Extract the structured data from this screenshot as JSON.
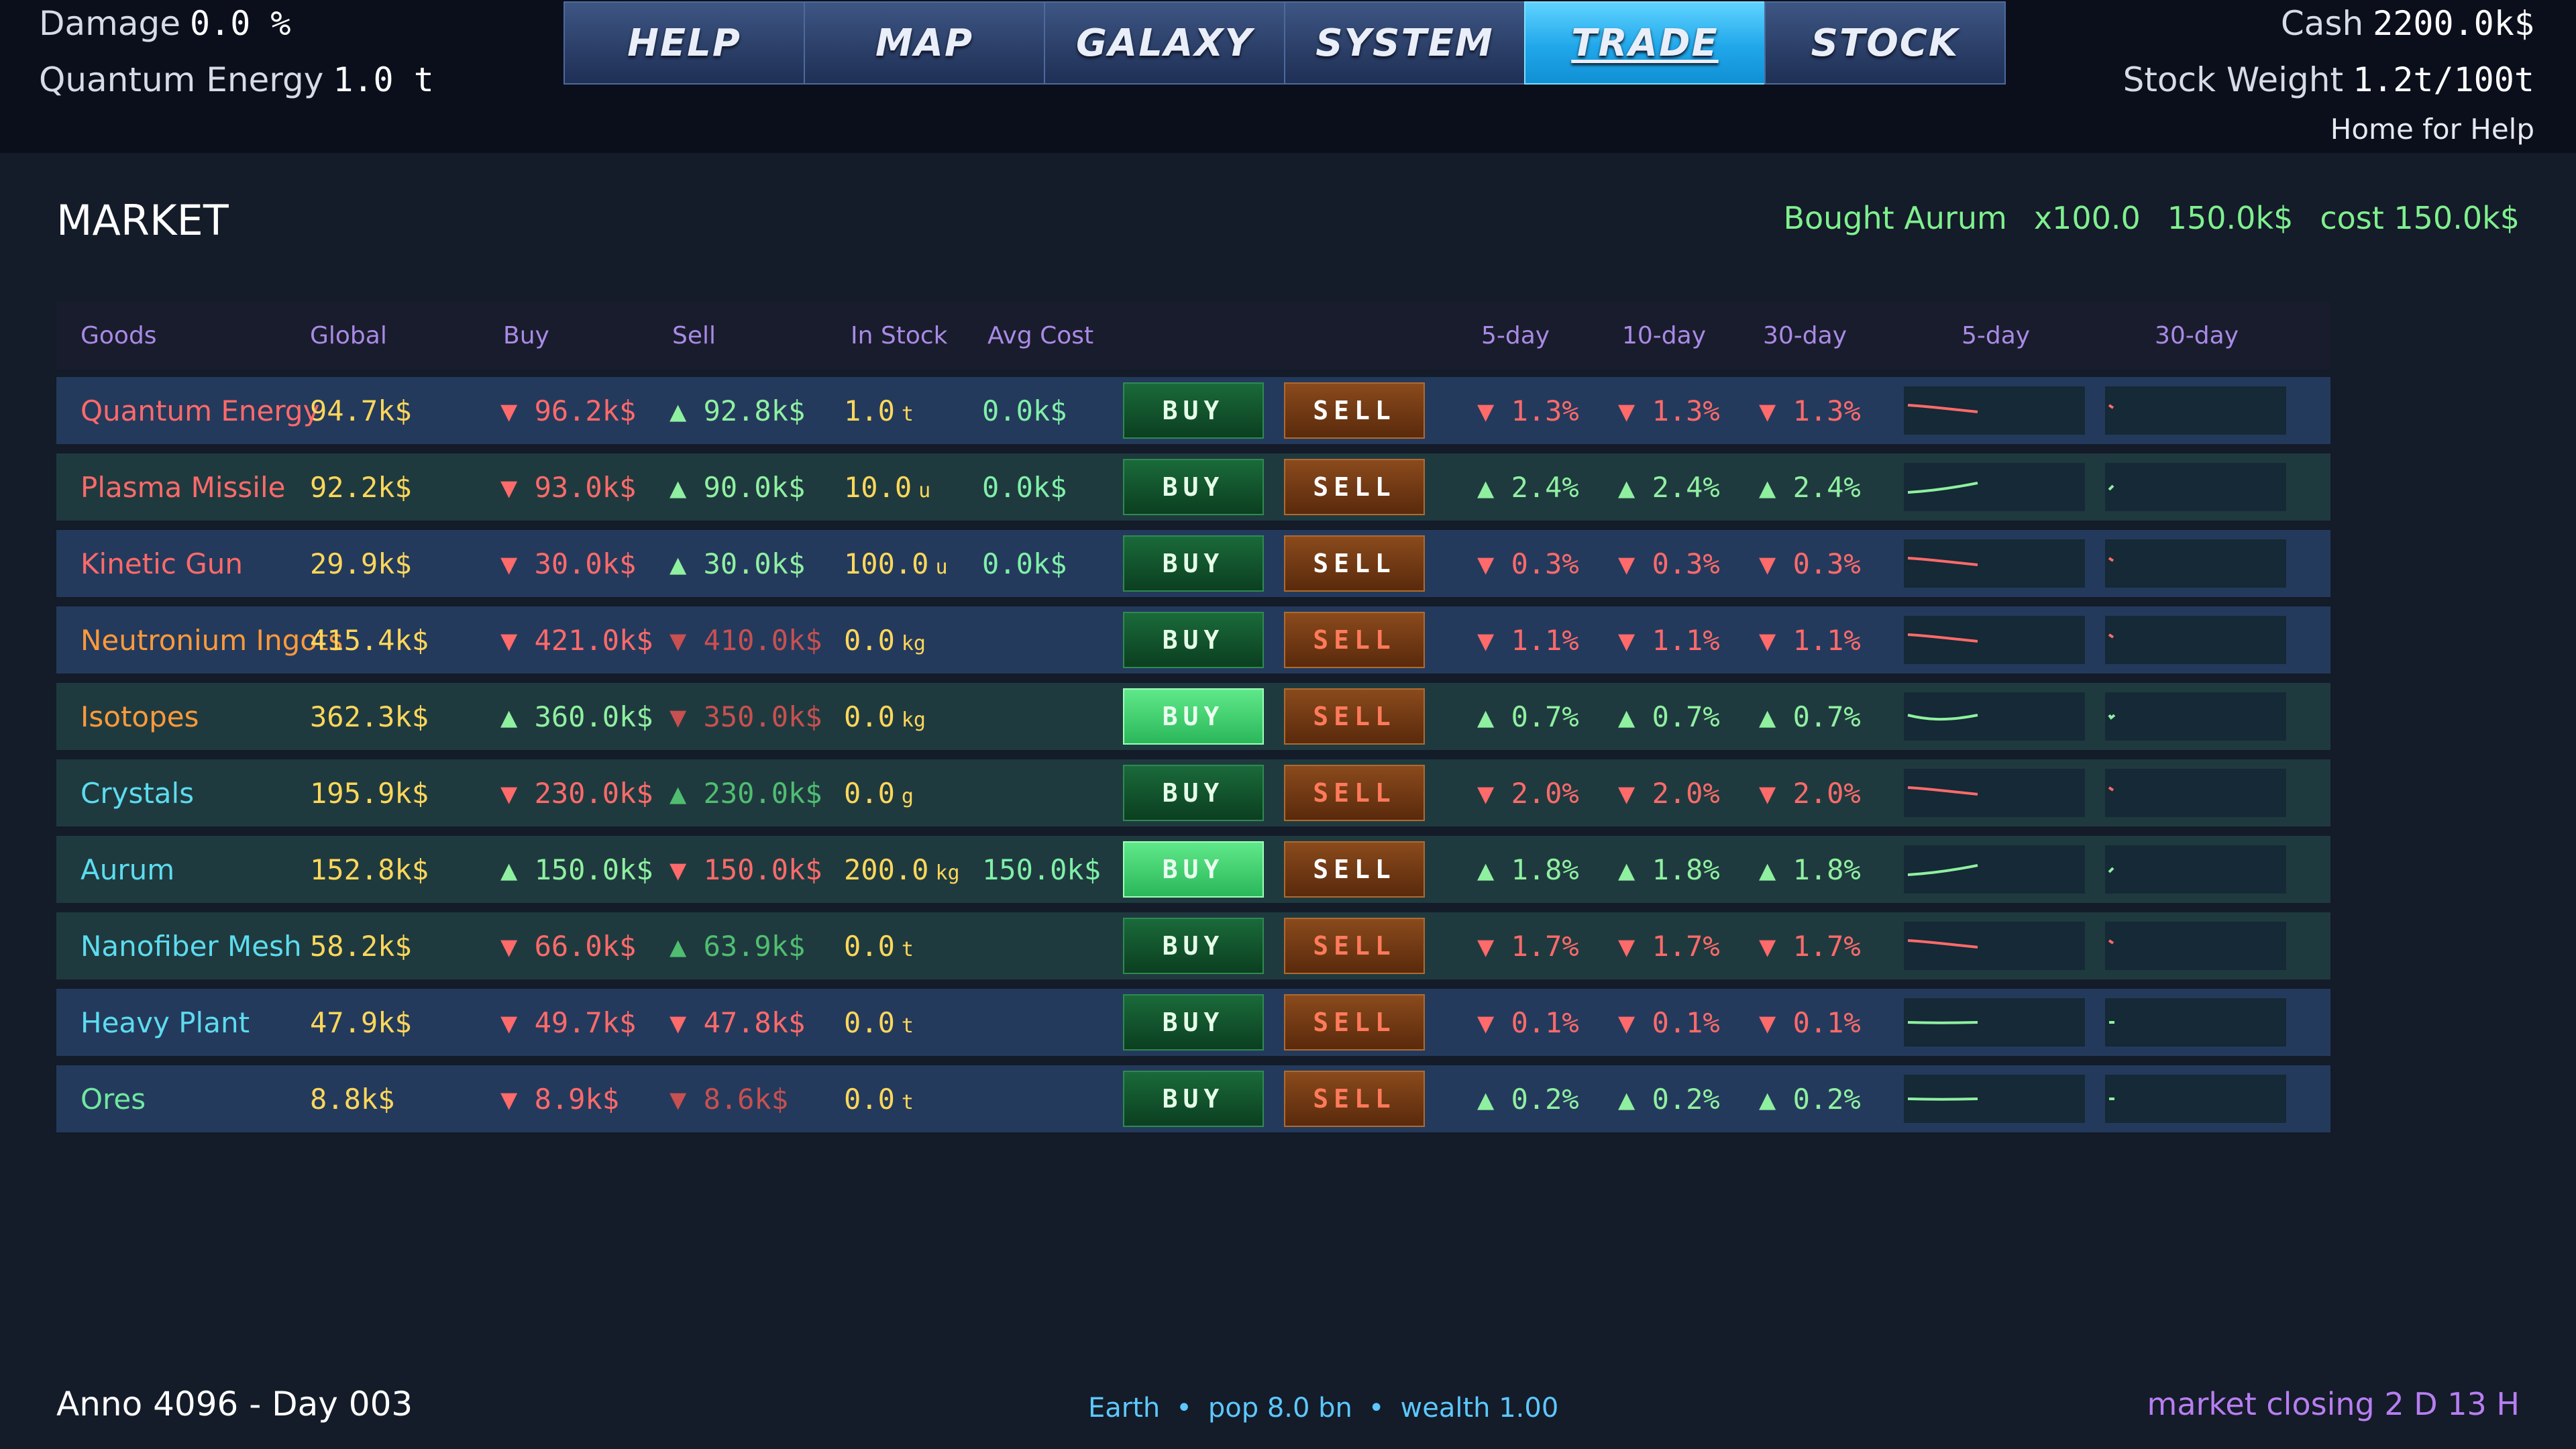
{
  "hud": {
    "damage_label": "Damage",
    "damage_value": "0.0 %",
    "qe_label": "Quantum Energy",
    "qe_value": "1.0 t",
    "cash_label": "Cash",
    "cash_value": "2200.0k$",
    "weight_label": "Stock Weight",
    "weight_value": "1.2t/100t",
    "help_hint": "Home for Help"
  },
  "tabs": [
    "HELP",
    "MAP",
    "GALAXY",
    "SYSTEM",
    "TRADE",
    "STOCK"
  ],
  "active_tab": "TRADE",
  "market": {
    "title": "MARKET",
    "last_trade": {
      "action": "Bought Aurum",
      "qty": "x100.0",
      "price": "150.0k$",
      "cost": "cost 150.0k$"
    },
    "columns": [
      "Goods",
      "Global",
      "Buy",
      "Sell",
      "In Stock",
      "Avg Cost",
      "5-day",
      "10-day",
      "30-day",
      "5-day",
      "30-day"
    ],
    "buy_label": "BUY",
    "sell_label": "SELL",
    "rows": [
      {
        "name": "Quantum Energy",
        "name_color": "#ff6a6a",
        "global": "94.7k$",
        "buy": "▼ 96.2k$",
        "buy_cls": "down",
        "sell": "▲ 92.8k$",
        "sell_cls": "up",
        "stock": "1.0",
        "unit": "t",
        "avg": "0.0k$",
        "d5": "▼ 1.3%",
        "d10": "▼ 1.3%",
        "d30": "▼ 1.3%",
        "trend": "down",
        "buy_lit": false,
        "sell_warn": false,
        "bg": "blue"
      },
      {
        "name": "Plasma Missile",
        "name_color": "#ff6a6a",
        "global": "92.2k$",
        "buy": "▼ 93.0k$",
        "buy_cls": "down",
        "sell": "▲ 90.0k$",
        "sell_cls": "up",
        "stock": "10.0",
        "unit": "u",
        "avg": "0.0k$",
        "d5": "▲ 2.4%",
        "d10": "▲ 2.4%",
        "d30": "▲ 2.4%",
        "trend": "up",
        "buy_lit": false,
        "sell_warn": false,
        "bg": "green"
      },
      {
        "name": "Kinetic Gun",
        "name_color": "#ff6a6a",
        "global": "29.9k$",
        "buy": "▼ 30.0k$",
        "buy_cls": "down",
        "sell": "▲ 30.0k$",
        "sell_cls": "up",
        "stock": "100.0",
        "unit": "u",
        "avg": "0.0k$",
        "d5": "▼ 0.3%",
        "d10": "▼ 0.3%",
        "d30": "▼ 0.3%",
        "trend": "down",
        "buy_lit": false,
        "sell_warn": false,
        "bg": "blue"
      },
      {
        "name": "Neutronium Ingots",
        "name_color": "#ff9a3a",
        "global": "415.4k$",
        "buy": "▼ 421.0k$",
        "buy_cls": "down",
        "sell": "▼ 410.0k$",
        "sell_cls": "dim-down",
        "stock": "0.0",
        "unit": "kg",
        "avg": "",
        "d5": "▼ 1.1%",
        "d10": "▼ 1.1%",
        "d30": "▼ 1.1%",
        "trend": "down",
        "buy_lit": false,
        "sell_warn": true,
        "bg": "blue"
      },
      {
        "name": "Isotopes",
        "name_color": "#ff9a3a",
        "global": "362.3k$",
        "buy": "▲ 360.0k$",
        "buy_cls": "up",
        "sell": "▼ 350.0k$",
        "sell_cls": "dim-down",
        "stock": "0.0",
        "unit": "kg",
        "avg": "",
        "d5": "▲ 0.7%",
        "d10": "▲ 0.7%",
        "d30": "▲ 0.7%",
        "trend": "upv",
        "buy_lit": true,
        "sell_warn": true,
        "bg": "green"
      },
      {
        "name": "Crystals",
        "name_color": "#5cdcef",
        "global": "195.9k$",
        "buy": "▼ 230.0k$",
        "buy_cls": "down",
        "sell": "▲ 230.0k$",
        "sell_cls": "dim-up",
        "stock": "0.0",
        "unit": "g",
        "avg": "",
        "d5": "▼ 2.0%",
        "d10": "▼ 2.0%",
        "d30": "▼ 2.0%",
        "trend": "down",
        "buy_lit": false,
        "sell_warn": true,
        "bg": "green"
      },
      {
        "name": "Aurum",
        "name_color": "#5cdcef",
        "global": "152.8k$",
        "buy": "▲ 150.0k$",
        "buy_cls": "up",
        "sell": "▼ 150.0k$",
        "sell_cls": "down",
        "stock": "200.0",
        "unit": "kg",
        "avg": "150.0k$",
        "d5": "▲ 1.8%",
        "d10": "▲ 1.8%",
        "d30": "▲ 1.8%",
        "trend": "up",
        "buy_lit": true,
        "sell_warn": false,
        "bg": "green"
      },
      {
        "name": "Nanofiber Mesh",
        "name_color": "#5cdcef",
        "global": "58.2k$",
        "buy": "▼ 66.0k$",
        "buy_cls": "down",
        "sell": "▲ 63.9k$",
        "sell_cls": "dim-up",
        "stock": "0.0",
        "unit": "t",
        "avg": "",
        "d5": "▼ 1.7%",
        "d10": "▼ 1.7%",
        "d30": "▼ 1.7%",
        "trend": "down",
        "buy_lit": false,
        "sell_warn": true,
        "bg": "green"
      },
      {
        "name": "Heavy Plant",
        "name_color": "#5cdcef",
        "global": "47.9k$",
        "buy": "▼ 49.7k$",
        "buy_cls": "down",
        "sell": "▼ 47.8k$",
        "sell_cls": "down",
        "stock": "0.0",
        "unit": "t",
        "avg": "",
        "d5": "▼ 0.1%",
        "d10": "▼ 0.1%",
        "d30": "▼ 0.1%",
        "trend": "flat",
        "buy_lit": false,
        "sell_warn": true,
        "bg": "blue"
      },
      {
        "name": "Ores",
        "name_color": "#6fe8a0",
        "global": "8.8k$",
        "buy": "▼ 8.9k$",
        "buy_cls": "down",
        "sell": "▼ 8.6k$",
        "sell_cls": "dim-down",
        "stock": "0.0",
        "unit": "t",
        "avg": "",
        "d5": "▲ 0.2%",
        "d10": "▲ 0.2%",
        "d30": "▲ 0.2%",
        "trend": "flat",
        "buy_lit": false,
        "sell_warn": true,
        "bg": "blue"
      }
    ]
  },
  "footer": {
    "date": "Anno 4096 - Day 003",
    "planet": "Earth",
    "pop": "pop 8.0 bn",
    "wealth": "wealth 1.00",
    "closing": "market closing 2 D 13 H"
  }
}
